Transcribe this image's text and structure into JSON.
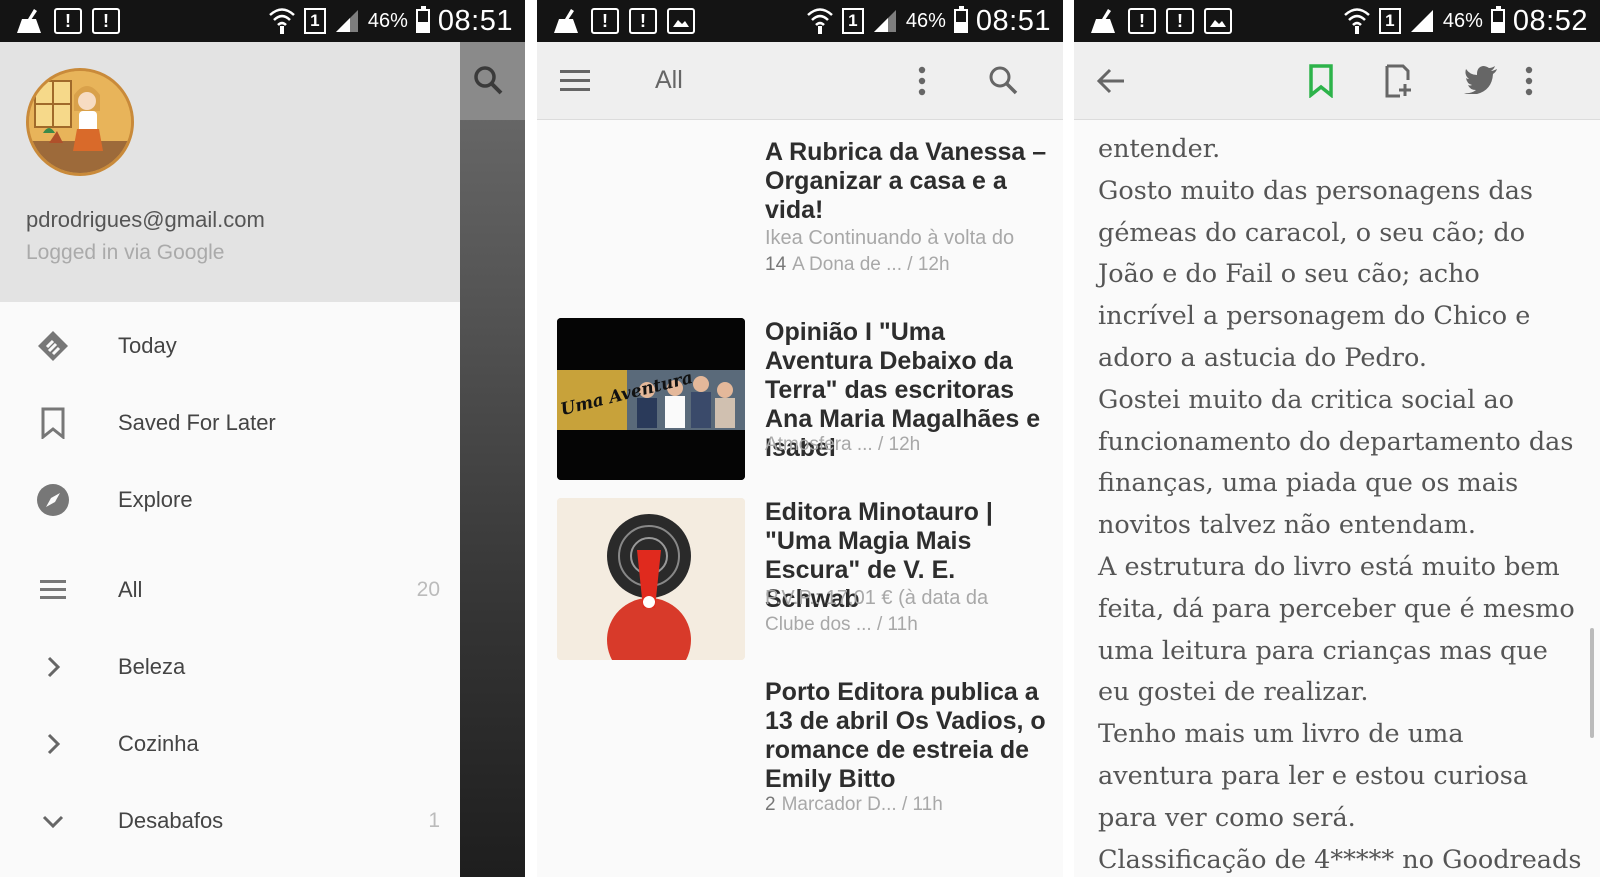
{
  "status": {
    "panel1": {
      "battery_pct": "46%",
      "time": "08:51",
      "sim": "1",
      "battery_level": 0.46
    },
    "panel2": {
      "battery_pct": "46%",
      "time": "08:51",
      "sim": "1",
      "battery_level": 0.46
    },
    "panel3": {
      "battery_pct": "46%",
      "time": "08:52",
      "sim": "1",
      "battery_level": 0.46
    },
    "notification_icons": [
      "cleaner-icon",
      "alert-icon",
      "alert-icon",
      "image-icon"
    ]
  },
  "drawer": {
    "email": "pdrodrigues@gmail.com",
    "login_method": "Logged in via Google",
    "items": [
      {
        "label": "Today",
        "icon": "feedly-icon",
        "count": ""
      },
      {
        "label": "Saved For Later",
        "icon": "bookmark-icon",
        "count": ""
      },
      {
        "label": "Explore",
        "icon": "compass-icon",
        "count": ""
      },
      {
        "label": "All",
        "icon": "list-icon",
        "count": "20"
      },
      {
        "label": "Beleza",
        "icon": "chevron-right-icon",
        "count": ""
      },
      {
        "label": "Cozinha",
        "icon": "chevron-right-icon",
        "count": ""
      },
      {
        "label": "Desabafos",
        "icon": "chevron-down-icon",
        "count": "1"
      }
    ]
  },
  "feed": {
    "title": "All",
    "articles": [
      {
        "title": "A Rubrica da Vanessa – Organizar a casa e a vida!",
        "snippet": "Ikea Continuando à volta do",
        "count": "14",
        "meta": "A Dona de ... / 12h"
      },
      {
        "title": "Opinião I \"Uma Aventura Debaixo da Terra\" das escritoras Ana Maria Magalhães e Isabel",
        "snippet": "",
        "count": "",
        "meta": "Atmosfera ... / 12h",
        "thumb_text": "Uma Aventura"
      },
      {
        "title": "Editora Minotauro | \"Uma Magia Mais Escura\" de V. E. Schwab",
        "snippet": "P.V.P.: 17,01 € (à data da",
        "count": "",
        "meta": "Clube dos ... / 11h"
      },
      {
        "title": "Porto Editora publica a 13 de abril Os Vadios, o romance de estreia de Emily Bitto",
        "snippet": "",
        "count": "2",
        "meta": "Marcador D... / 11h"
      }
    ]
  },
  "reader": {
    "text": "entender.\nGosto muito das personagens das gémeas do caracol, o seu cão; do João e do Fail o seu cão; acho incrível a personagem do Chico e adoro a astucia do Pedro.\nGostei muito da critica social ao funcionamento do departamento das finanças, uma piada que os mais novitos talvez não entendam.\nA estrutura do livro está muito bem feita, dá para perceber que é mesmo uma leitura para crianças mas que eu gostei de realizar.\nTenho mais um livro de uma aventura para ler e estou curiosa para ver como será.\nClassificação de 4***** no Goodreads",
    "paragraphs": [
      "entender.",
      "Gosto muito das personagens das gémeas do caracol, o seu cão; do João e do Fail o seu cão; acho incrível a personagem do Chico e adoro a astucia do Pedro.",
      "Gostei muito da critica social ao funcionamento do departamento das finanças, uma piada que os mais novitos talvez não entendam.",
      "A estrutura do livro está muito bem feita, dá para perceber que é mesmo uma leitura para crianças mas que eu gostei de realizar.",
      "Tenho mais um livro de uma aventura para ler e estou curiosa para ver como será.",
      "Classificação de 4***** no Goodreads"
    ]
  },
  "colors": {
    "accent_green": "#2db34a",
    "status_bar": "#141414",
    "toolbar": "#efefef"
  }
}
